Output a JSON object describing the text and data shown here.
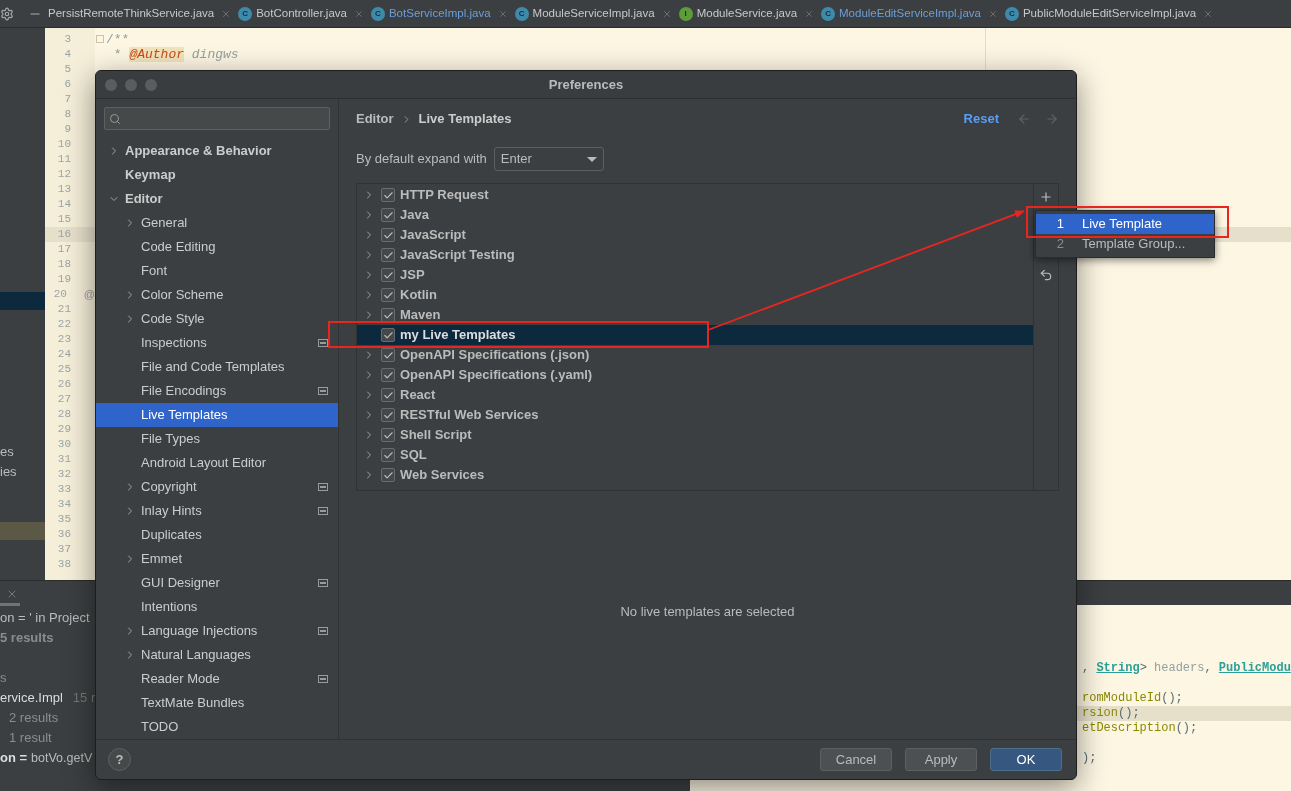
{
  "tab_bar": {
    "tabs": [
      {
        "label": "PersistRemoteThinkService.java",
        "modified": false
      },
      {
        "label": "BotController.java",
        "icon_letter": "C",
        "color": "#3c8bad",
        "modified": false
      },
      {
        "label": "BotServiceImpl.java",
        "icon_letter": "C",
        "color": "#3c8bad",
        "modified": true
      },
      {
        "label": "ModuleServiceImpl.java",
        "icon_letter": "C",
        "color": "#3c8bad",
        "modified": false
      },
      {
        "label": "ModuleService.java",
        "icon_letter": "I",
        "color": "#5e9c3a",
        "modified": false
      },
      {
        "label": "ModuleEditServiceImpl.java",
        "icon_letter": "C",
        "color": "#3c8bad",
        "modified": true
      },
      {
        "label": "PublicModuleEditServiceImpl.java",
        "icon_letter": "C",
        "color": "#3c8bad",
        "modified": false
      }
    ]
  },
  "project_panel": {
    "texts": [
      "es",
      "ies"
    ]
  },
  "editor": {
    "lines": [
      {
        "number": "3",
        "kind": "code",
        "fold": true,
        "tokens": [
          {
            "kind": "comment",
            "text": "/**"
          }
        ]
      },
      {
        "number": "4",
        "kind": "code",
        "tokens": [
          {
            "kind": "comment",
            "text": " * "
          },
          {
            "kind": "tag",
            "text": "@Author"
          },
          {
            "kind": "doc",
            "text": " dingws"
          }
        ]
      },
      {
        "number": "5",
        "kind": "blank"
      },
      {
        "number": "6",
        "current": false,
        "kind": "blank"
      },
      {
        "number": "7",
        "current": false,
        "kind": "blank"
      },
      {
        "number": "8",
        "current": false,
        "kind": "blank"
      },
      {
        "number": "9",
        "current": false,
        "kind": "blank"
      },
      {
        "number": "10",
        "current": false,
        "kind": "blank"
      },
      {
        "number": "11",
        "current": false,
        "kind": "blank"
      },
      {
        "number": "12",
        "current": false,
        "kind": "blank"
      },
      {
        "number": "13",
        "current": false,
        "kind": "blank"
      },
      {
        "number": "14",
        "current": false,
        "kind": "blank"
      },
      {
        "number": "15",
        "current": false,
        "kind": "blank"
      },
      {
        "number": "16",
        "current": true,
        "kind": "blank"
      },
      {
        "number": "17",
        "current": false,
        "kind": "blank"
      },
      {
        "number": "18",
        "current": false,
        "kind": "blank"
      },
      {
        "number": "19",
        "current": false,
        "kind": "blank"
      },
      {
        "number": "20",
        "current": false,
        "kind": "blank",
        "gutter_mark": "@"
      },
      {
        "number": "21",
        "current": false,
        "kind": "blank"
      },
      {
        "number": "22",
        "current": false,
        "kind": "blank"
      },
      {
        "number": "23",
        "current": false,
        "kind": "blank"
      },
      {
        "number": "24",
        "current": false,
        "kind": "blank"
      },
      {
        "number": "25",
        "current": false,
        "kind": "blank"
      },
      {
        "number": "26",
        "current": false,
        "kind": "blank"
      },
      {
        "number": "27",
        "current": false,
        "kind": "blank"
      },
      {
        "number": "28",
        "current": false,
        "kind": "blank"
      },
      {
        "number": "29",
        "current": false,
        "kind": "blank"
      },
      {
        "number": "30",
        "current": false,
        "kind": "blank"
      },
      {
        "number": "31",
        "current": false,
        "kind": "blank"
      },
      {
        "number": "32",
        "current": false,
        "kind": "blank"
      },
      {
        "number": "33",
        "current": false,
        "kind": "blank"
      },
      {
        "number": "34",
        "current": false,
        "kind": "blank"
      },
      {
        "number": "35",
        "current": false,
        "kind": "blank"
      },
      {
        "number": "36",
        "current": false,
        "kind": "blank"
      },
      {
        "number": "37",
        "current": false,
        "kind": "blank"
      },
      {
        "number": "38",
        "current": false,
        "kind": "blank"
      }
    ]
  },
  "find_panel": {
    "lines": [
      {
        "kind": "query",
        "text": "on = ' in Project"
      },
      {
        "kind": "count",
        "text": "5 results"
      },
      {
        "kind": "blank"
      },
      {
        "kind": "plain",
        "text": "s"
      },
      {
        "kind": "file",
        "text": "ervice.Impl",
        "extra": "15 r"
      },
      {
        "kind": "sub",
        "text": "2 results"
      },
      {
        "kind": "sub",
        "text": "1 result"
      },
      {
        "kind": "match",
        "text": "on =",
        "extra": "botVo.getV"
      }
    ]
  },
  "bottom_editor": {
    "lines": [
      {
        "kind": "code",
        "current": false,
        "tokens": [
          {
            "kind": "plain",
            "text": ", "
          },
          {
            "kind": "type",
            "text": "String"
          },
          {
            "kind": "plain",
            "text": "> "
          },
          {
            "kind": "param",
            "text": "headers"
          },
          {
            "kind": "plain",
            "text": ", "
          },
          {
            "kind": "type",
            "text": "PublicModu"
          }
        ]
      },
      {
        "kind": "blank",
        "current": false
      },
      {
        "kind": "code",
        "current": false,
        "tokens": [
          {
            "kind": "method",
            "text": "romModuleId"
          },
          {
            "kind": "plain",
            "text": "();"
          }
        ]
      },
      {
        "kind": "code",
        "current": true,
        "tokens": [
          {
            "kind": "method",
            "text": "rsion"
          },
          {
            "kind": "plain",
            "text": "();"
          }
        ]
      },
      {
        "kind": "code",
        "current": false,
        "tokens": [
          {
            "kind": "method",
            "text": "etDescription"
          },
          {
            "kind": "plain",
            "text": "();"
          }
        ]
      },
      {
        "kind": "blank",
        "current": false
      },
      {
        "kind": "code",
        "current": false,
        "tokens": [
          {
            "kind": "plain",
            "text": ");"
          }
        ]
      }
    ]
  },
  "dialog": {
    "title": "Preferences",
    "sidebar": {
      "items": [
        {
          "label": "Appearance & Behavior",
          "expanded": false,
          "selected": false
        },
        {
          "label": "Keymap",
          "selected": false
        },
        {
          "label": "Editor",
          "expanded": true,
          "selected": false,
          "children": [
            {
              "label": "General",
              "expanded": false,
              "selected": false,
              "project_icon": false
            },
            {
              "label": "Code Editing",
              "selected": false,
              "project_icon": false
            },
            {
              "label": "Font",
              "selected": false,
              "project_icon": false
            },
            {
              "label": "Color Scheme",
              "expanded": false,
              "selected": false,
              "project_icon": false
            },
            {
              "label": "Code Style",
              "expanded": false,
              "selected": false,
              "project_icon": false
            },
            {
              "label": "Inspections",
              "selected": false,
              "project_icon": true
            },
            {
              "label": "File and Code Templates",
              "selected": false,
              "project_icon": false
            },
            {
              "label": "File Encodings",
              "selected": false,
              "project_icon": true
            },
            {
              "label": "Live Templates",
              "selected": true,
              "project_icon": false
            },
            {
              "label": "File Types",
              "selected": false,
              "project_icon": false
            },
            {
              "label": "Android Layout Editor",
              "selected": false,
              "project_icon": false
            },
            {
              "label": "Copyright",
              "expanded": false,
              "selected": false,
              "project_icon": true
            },
            {
              "label": "Inlay Hints",
              "expanded": false,
              "selected": false,
              "project_icon": true
            },
            {
              "label": "Duplicates",
              "selected": false,
              "project_icon": false
            },
            {
              "label": "Emmet",
              "expanded": false,
              "selected": false,
              "project_icon": false
            },
            {
              "label": "GUI Designer",
              "selected": false,
              "project_icon": true
            },
            {
              "label": "Intentions",
              "selected": false,
              "project_icon": false
            },
            {
              "label": "Language Injections",
              "expanded": false,
              "selected": false,
              "project_icon": true
            },
            {
              "label": "Natural Languages",
              "expanded": false,
              "selected": false,
              "project_icon": false
            },
            {
              "label": "Reader Mode",
              "selected": false,
              "project_icon": true
            },
            {
              "label": "TextMate Bundles",
              "selected": false,
              "project_icon": false
            },
            {
              "label": "TODO",
              "selected": false,
              "project_icon": false
            }
          ]
        }
      ]
    },
    "breadcrumb": [
      "Editor",
      "Live Templates"
    ],
    "reset": "Reset",
    "expand_with": {
      "label": "By default expand with",
      "value": "Enter"
    },
    "templates": [
      {
        "label": "HTTP Request",
        "checked": true,
        "expanded": false,
        "selected": false
      },
      {
        "label": "Java",
        "checked": true,
        "expanded": false,
        "selected": false
      },
      {
        "label": "JavaScript",
        "checked": true,
        "expanded": false,
        "selected": false
      },
      {
        "label": "JavaScript Testing",
        "checked": true,
        "expanded": false,
        "selected": false
      },
      {
        "label": "JSP",
        "checked": true,
        "expanded": false,
        "selected": false
      },
      {
        "label": "Kotlin",
        "checked": true,
        "expanded": false,
        "selected": false
      },
      {
        "label": "Maven",
        "checked": true,
        "expanded": false,
        "selected": false
      },
      {
        "label": "my Live Templates",
        "checked": true,
        "selected": true
      },
      {
        "label": "OpenAPI Specifications (.json)",
        "checked": true,
        "expanded": false,
        "selected": false
      },
      {
        "label": "OpenAPI Specifications (.yaml)",
        "checked": true,
        "expanded": false,
        "selected": false
      },
      {
        "label": "React",
        "checked": true,
        "expanded": false,
        "selected": false
      },
      {
        "label": "RESTful Web Services",
        "checked": true,
        "expanded": false,
        "selected": false
      },
      {
        "label": "Shell Script",
        "checked": true,
        "expanded": false,
        "selected": false
      },
      {
        "label": "SQL",
        "checked": true,
        "expanded": false,
        "selected": false
      },
      {
        "label": "Web Services",
        "checked": true,
        "expanded": false,
        "selected": false
      }
    ],
    "empty_message": "No live templates are selected",
    "help": "?",
    "buttons": [
      {
        "label": "Cancel",
        "primary": false
      },
      {
        "label": "Apply",
        "primary": false
      },
      {
        "label": "OK",
        "primary": true
      }
    ]
  },
  "add_menu": {
    "items": [
      {
        "number": "1",
        "label": "Live Template",
        "selected": true
      },
      {
        "number": "2",
        "label": "Template Group...",
        "selected": false
      }
    ]
  }
}
